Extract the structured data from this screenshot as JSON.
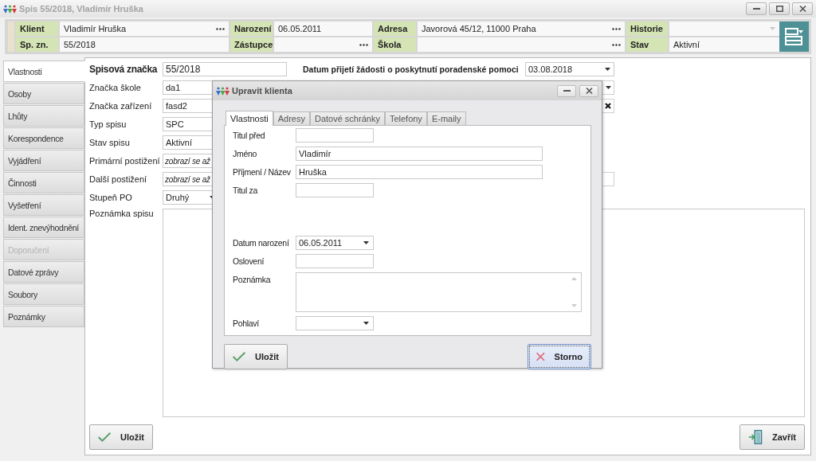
{
  "window": {
    "title": "Spis 55/2018, Vladimír Hruška"
  },
  "header": {
    "rows": [
      [
        {
          "label": "Klient",
          "value": "Vladimír Hruška",
          "kind": "lookup"
        },
        {
          "label": "Narození",
          "value": "06.05.2011",
          "kind": "text"
        },
        {
          "label": "Adresa",
          "value": "Javorová 45/12, 11000 Praha",
          "kind": "lookup"
        },
        {
          "label": "Historie",
          "kind": "dropdown"
        }
      ],
      [
        {
          "label": "Sp. zn.",
          "value": "55/2018",
          "kind": "text"
        },
        {
          "label": "Zástupce",
          "kind": "lookup"
        },
        {
          "label": "Škola",
          "kind": "lookup"
        },
        {
          "label": "Stav",
          "value": "Aktivní",
          "kind": "text"
        }
      ]
    ]
  },
  "sidebar": {
    "items": [
      {
        "label": "Vlastnosti",
        "selected": true,
        "disabled": false
      },
      {
        "label": "Osoby",
        "selected": false,
        "disabled": false
      },
      {
        "label": "Lhůty",
        "selected": false,
        "disabled": false
      },
      {
        "label": "Korespondence",
        "selected": false,
        "disabled": false
      },
      {
        "label": "Vyjádření",
        "selected": false,
        "disabled": false
      },
      {
        "label": "Činnosti",
        "selected": false,
        "disabled": false
      },
      {
        "label": "Vyšetření",
        "selected": false,
        "disabled": false
      },
      {
        "label": "Ident. znevýhodnění",
        "selected": false,
        "disabled": false
      },
      {
        "label": "Doporučení",
        "selected": false,
        "disabled": true
      },
      {
        "label": "Datové zprávy",
        "selected": false,
        "disabled": false
      },
      {
        "label": "Soubory",
        "selected": false,
        "disabled": false
      },
      {
        "label": "Poznámky",
        "selected": false,
        "disabled": false
      }
    ]
  },
  "form": {
    "case_number": {
      "label": "Spisová značka",
      "value": "55/2018"
    },
    "request_date": {
      "label": "Datum přijetí žádosti o poskytnutí poradenské pomoci",
      "value": "03.08.2018"
    },
    "fields": [
      {
        "label": "Značka škole",
        "value": "da1",
        "kind": "text"
      },
      {
        "label": "Značka zařízení",
        "value": "fasd2",
        "kind": "text"
      },
      {
        "label": "Typ spisu",
        "value": "SPC",
        "kind": "text"
      },
      {
        "label": "Stav spisu",
        "value": "Aktivní",
        "kind": "text"
      },
      {
        "label": "Primární postižení",
        "value": "zobrazí se až",
        "kind": "hint"
      },
      {
        "label": "Další postižení",
        "value": "zobrazí se až",
        "kind": "hint"
      },
      {
        "label": "Stupeň PO",
        "value": "Druhý",
        "kind": "dropdown"
      }
    ],
    "note": {
      "label": "Poznámka spisu"
    }
  },
  "buttons": [
    {
      "label": "Uložit",
      "kind": "save"
    },
    {
      "label": "Zavřít",
      "kind": "close"
    }
  ],
  "dialog": {
    "title": "Upravit klienta",
    "tabs": [
      {
        "label": "Vlastnosti",
        "selected": true
      },
      {
        "label": "Adresy",
        "selected": false
      },
      {
        "label": "Datové schránky",
        "selected": false
      },
      {
        "label": "Telefony",
        "selected": false
      },
      {
        "label": "E-maily",
        "selected": false
      }
    ],
    "fields": [
      {
        "label": "Titul před",
        "kind": "short"
      },
      {
        "label": "Jméno",
        "value": "Vladimír",
        "kind": "long"
      },
      {
        "label": "Příjmení / Název",
        "value": "Hruška",
        "kind": "long"
      },
      {
        "label": "Titul za",
        "kind": "short"
      },
      {
        "label": "Datum narození",
        "value": "06.05.2011",
        "kind": "date"
      },
      {
        "label": "Oslovení",
        "kind": "short"
      },
      {
        "label": "Poznámka",
        "kind": "memo"
      },
      {
        "label": "Pohlaví",
        "kind": "select"
      }
    ],
    "buttons": [
      {
        "label": "Uložit",
        "kind": "save",
        "focused": false
      },
      {
        "label": "Storno",
        "kind": "cancel",
        "focused": true
      }
    ]
  }
}
